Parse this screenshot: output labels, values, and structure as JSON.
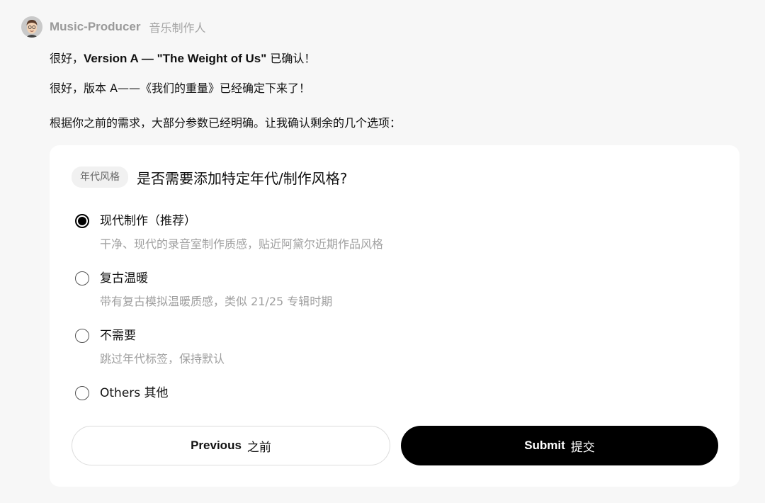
{
  "sender": {
    "name": "Music-Producer",
    "role": "音乐制作人"
  },
  "messages": {
    "line1_prefix": "很好，",
    "line1_bold": "Version A — \"The Weight of Us\"",
    "line1_suffix": " 已确认！",
    "line2": "很好，版本 A——《我们的重量》已经确定下来了！",
    "line3": "根据你之前的需求，大部分参数已经明确。让我确认剩余的几个选项："
  },
  "question": {
    "tag": "年代风格",
    "text": "是否需要添加特定年代/制作风格?"
  },
  "options": [
    {
      "label": "现代制作（推荐）",
      "desc": "干净、现代的录音室制作质感，贴近阿黛尔近期作品风格",
      "selected": true
    },
    {
      "label": "复古温暖",
      "desc": "带有复古模拟温暖质感，类似 21/25 专辑时期",
      "selected": false
    },
    {
      "label": "不需要",
      "desc": "跳过年代标签，保持默认",
      "selected": false
    },
    {
      "label": "Others  其他",
      "desc": "",
      "selected": false
    }
  ],
  "buttons": {
    "previous_en": "Previous",
    "previous_cn": "之前",
    "submit_en": "Submit",
    "submit_cn": "提交"
  },
  "colors": {
    "background": "#f7f7f7",
    "card": "#ffffff",
    "submit_bg": "#000000",
    "muted_text": "#a0a0a0"
  }
}
